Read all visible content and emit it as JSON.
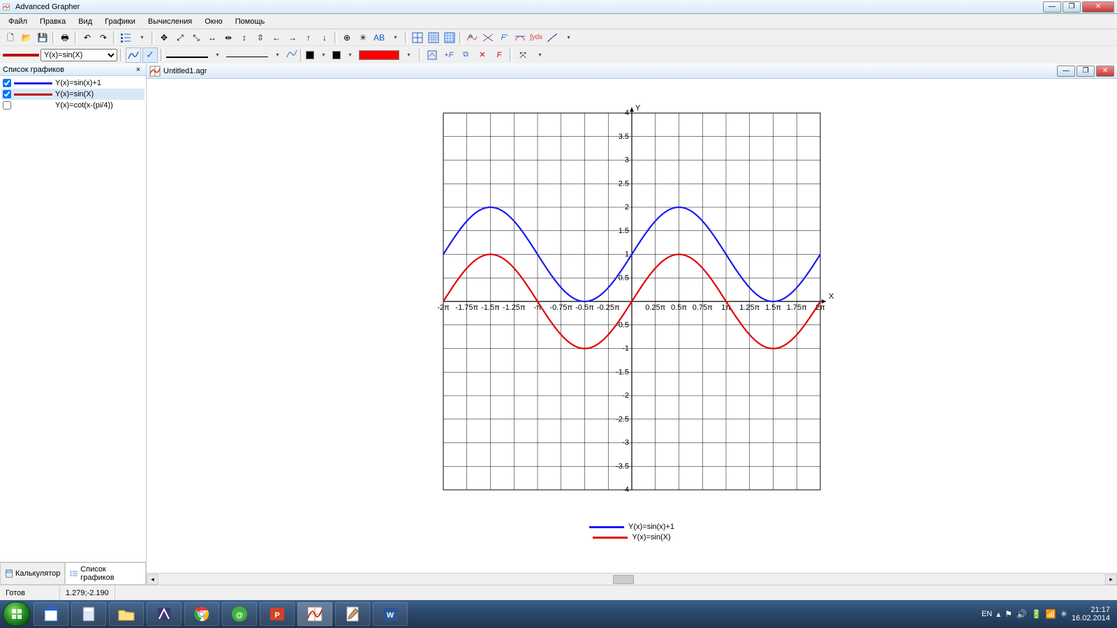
{
  "window": {
    "title": "Advanced Grapher",
    "doc_title": "Untitled1.agr"
  },
  "menu": [
    "Файл",
    "Правка",
    "Вид",
    "Графики",
    "Вычисления",
    "Окно",
    "Помощь"
  ],
  "sidebar": {
    "title": "Список графиков",
    "items": [
      {
        "checked": true,
        "color": "#1a1af0",
        "label": "Y(x)=sin(x)+1"
      },
      {
        "checked": true,
        "color": "#c00000",
        "label": "Y(x)=sin(X)"
      },
      {
        "checked": false,
        "color": "",
        "label": "Y(x)=cot(x-(pi/4))"
      }
    ],
    "tabs": {
      "calc": "Калькулятор",
      "list": "Список графиков"
    }
  },
  "toolbar2": {
    "current_function": "Y(x)=sin(X)",
    "current_color": "#c00000",
    "fill_color": "#ff0000"
  },
  "chart_data": {
    "type": "line",
    "xlabel": "X",
    "ylabel": "Y",
    "xlim": [
      -6.2832,
      6.2832
    ],
    "ylim": [
      -4,
      4
    ],
    "x_ticks_labels": [
      "-2π",
      "-1.75π",
      "-1.5π",
      "-1.25π",
      "-π",
      "-0.75π",
      "-0.5π",
      "-0.25π",
      "",
      "0.25π",
      "0.5π",
      "0.75π",
      "1π",
      "1.25π",
      "1.5π",
      "1.75π",
      "2π"
    ],
    "y_ticks": [
      -4,
      -3.5,
      -3,
      -2.5,
      -2,
      -1.5,
      -1,
      -0.5,
      0.5,
      1,
      1.5,
      2,
      2.5,
      3,
      3.5,
      4
    ],
    "series": [
      {
        "name": "Y(x)=sin(x)+1",
        "color": "#1a1af0",
        "fn": "sin(x)+1"
      },
      {
        "name": "Y(x)=sin(X)",
        "color": "#e00000",
        "fn": "sin(x)"
      }
    ],
    "legend_position": "bottom"
  },
  "status": {
    "state": "Готов",
    "coords": "1.279;-2.190"
  },
  "taskbar": {
    "lang": "EN",
    "time": "21:17",
    "date": "16.02.2014"
  }
}
